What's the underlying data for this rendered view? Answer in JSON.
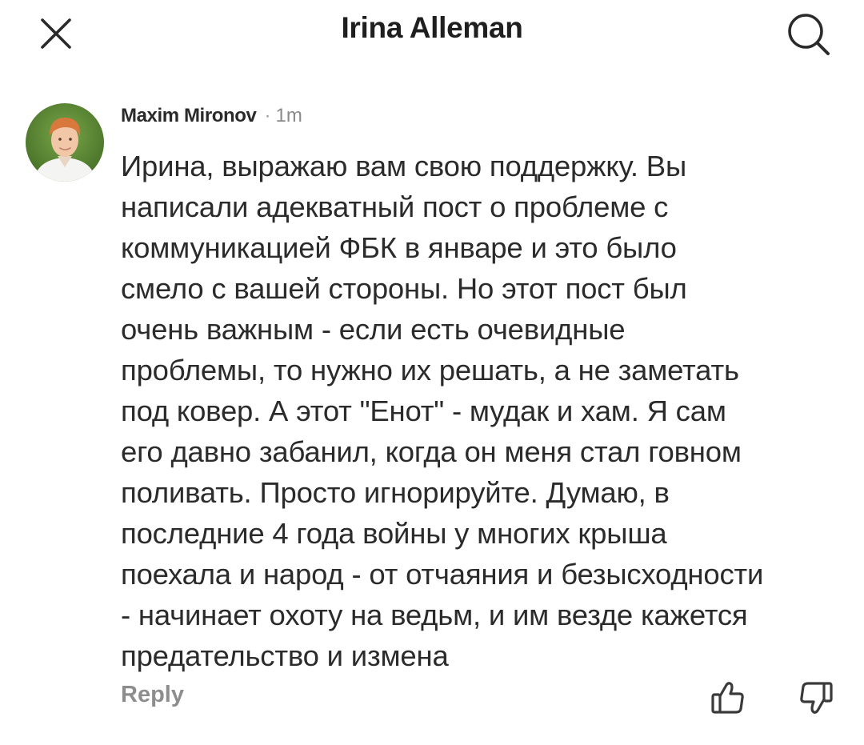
{
  "header": {
    "title": "Irina Alleman",
    "close_icon": "close-icon",
    "search_icon": "search-icon"
  },
  "comment": {
    "author": "Maxim Mironov",
    "separator": "·",
    "time": "1m",
    "avatar_icon": "avatar",
    "text": "Ирина, выражаю вам свою поддержку. Вы\nнаписали адекватный пост о проблеме с\nкоммуникацией ФБК в январе и это было\nсмело с вашей стороны. Но этот пост был\nочень важным - если есть очевидные\nпроблемы, то нужно их решать, а не заметать\nпод ковер. А этот \"Енот\" - мудак и хам. Я сам\nего давно забанил, когда он меня стал говном\nполивать. Просто игнорируйте. Думаю, в\nпоследние 4 года войны у многих крыша\nпоехала и народ - от отчаяния и безысходности\n- начинает охоту на ведьм, и им везде кажется\nпредательство и измена",
    "reply_label": "Reply",
    "like_icon": "thumbs-up-icon",
    "dislike_icon": "thumbs-down-icon"
  },
  "colors": {
    "text": "#2b2b2b",
    "muted": "#8d8d8d",
    "icon": "#3a3a3a"
  }
}
